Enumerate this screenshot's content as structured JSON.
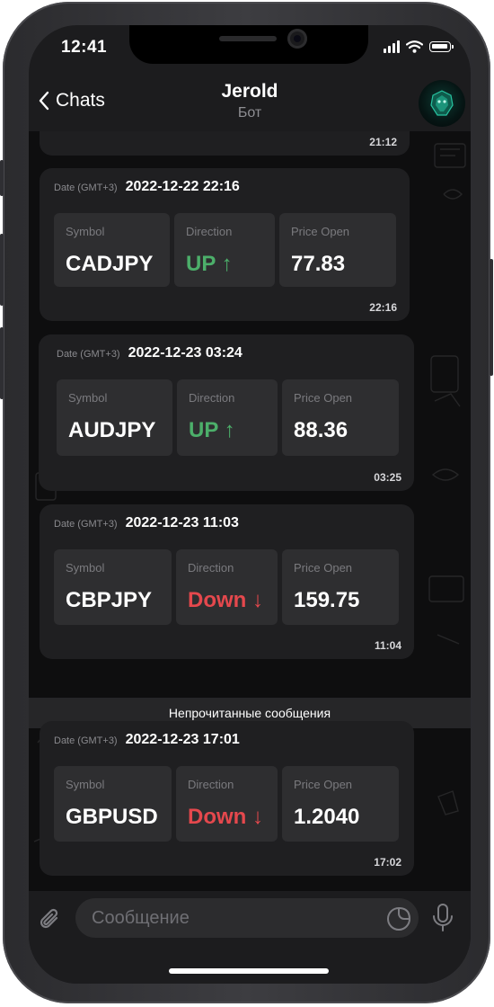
{
  "status": {
    "time": "12:41"
  },
  "header": {
    "back_label": "Chats",
    "title": "Jerold",
    "subtitle": "Бот"
  },
  "messages": [
    {
      "time": "21:12"
    },
    {
      "date_label": "Date (GMT+3)",
      "date": "2022-12-22 22:16",
      "symbol_label": "Symbol",
      "symbol": "CADJPY",
      "direction_label": "Direction",
      "direction": "UP ↑",
      "price_label": "Price Open",
      "price": "77.83",
      "time": "22:16"
    },
    {
      "date_label": "Date (GMT+3)",
      "date": "2022-12-23 03:24",
      "symbol_label": "Symbol",
      "symbol": "AUDJPY",
      "direction_label": "Direction",
      "direction": "UP ↑",
      "price_label": "Price Open",
      "price": "88.36",
      "time": "03:25"
    },
    {
      "date_label": "Date (GMT+3)",
      "date": "2022-12-23 11:03",
      "symbol_label": "Symbol",
      "symbol": "CBPJPY",
      "direction_label": "Direction",
      "direction": "Down ↓",
      "price_label": "Price Open",
      "price": "159.75",
      "time": "11:04"
    },
    {
      "date_label": "Date (GMT+3)",
      "date": "2022-12-23 17:01",
      "symbol_label": "Symbol",
      "symbol": "GBPUSD",
      "direction_label": "Direction",
      "direction": "Down ↓",
      "price_label": "Price Open",
      "price": "1.2040",
      "time": "17:02"
    }
  ],
  "unread_divider": "Непрочитанные сообщения",
  "composer": {
    "placeholder": "Сообщение"
  },
  "colors": {
    "up": "#4caf6a",
    "down": "#e5484d",
    "background": "#1c1c1e"
  },
  "icons": [
    "back-chevron-icon",
    "signal-icon",
    "wifi-icon",
    "battery-icon",
    "attachment-icon",
    "sticker-icon",
    "microphone-icon"
  ]
}
